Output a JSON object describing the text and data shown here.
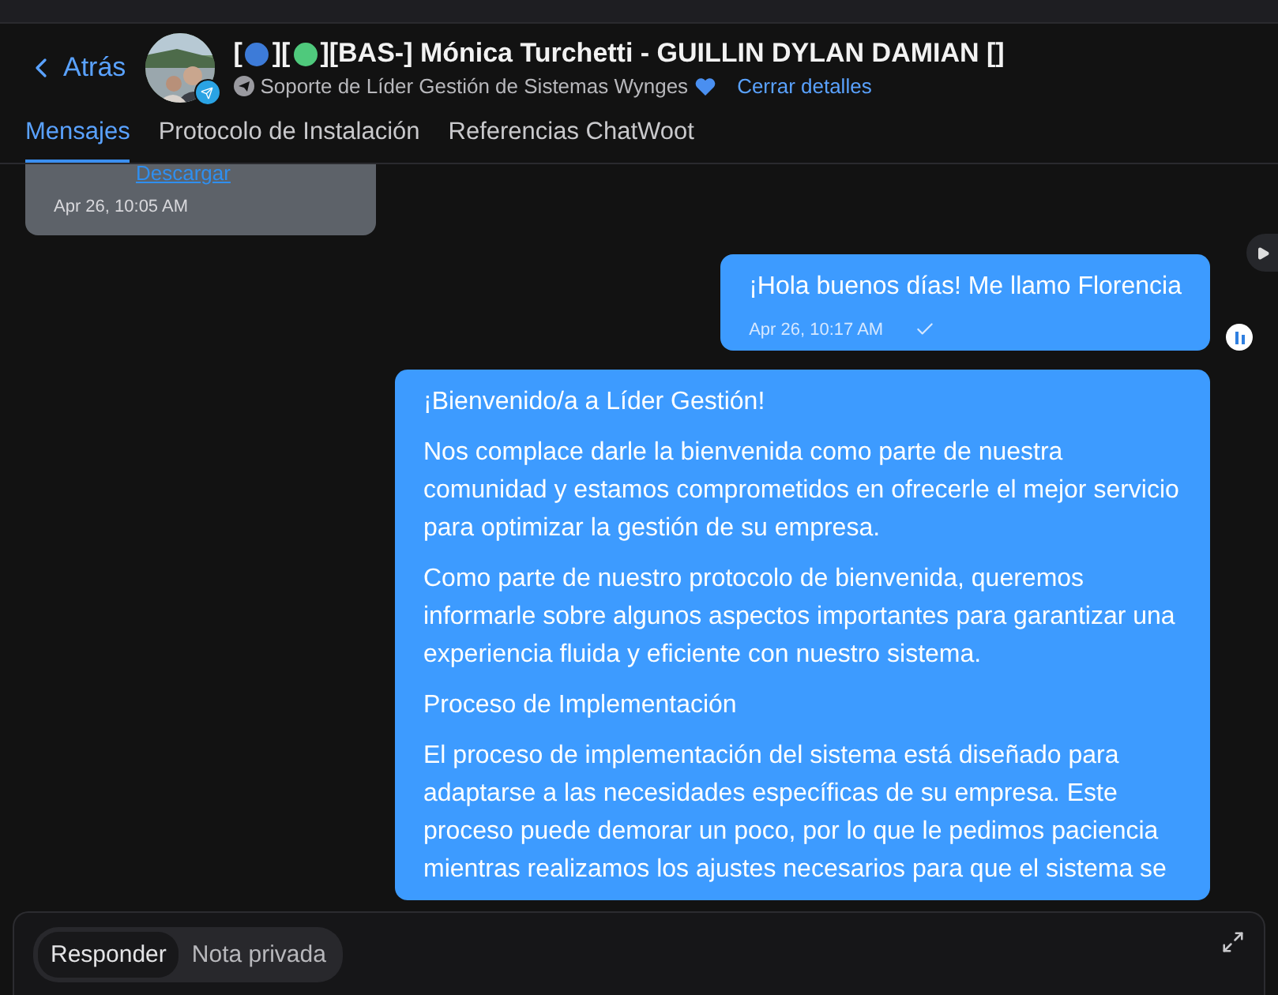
{
  "header": {
    "back": "Atrás",
    "title_parts": [
      {
        "kind": "text",
        "text": "["
      },
      {
        "kind": "dot",
        "color": "#3d7bd8"
      },
      {
        "kind": "text",
        "text": "]["
      },
      {
        "kind": "dot",
        "color": "#4fc97c"
      },
      {
        "kind": "text",
        "text": "][BAS-] Mónica Turchetti - GUILLIN DYLAN DAMIAN []"
      }
    ],
    "inbox": "Soporte de Líder Gestión de Sistemas Wynges",
    "close_details": "Cerrar detalles"
  },
  "tabs": [
    {
      "label": "Mensajes",
      "selected": true
    },
    {
      "label": "Protocolo de Instalación",
      "selected": false
    },
    {
      "label": "Referencias ChatWoot",
      "selected": false
    }
  ],
  "messages": [
    {
      "kind": "incoming",
      "link": "Descargar",
      "time": "Apr 26, 10:05 AM"
    },
    {
      "kind": "outgoing",
      "paragraphs": [
        "¡Hola buenos días! Me llamo Florencia"
      ],
      "time": "Apr 26, 10:17 AM",
      "sent": true
    },
    {
      "kind": "outgoing",
      "paragraphs": [
        "¡Bienvenido/a a Líder Gestión!",
        "Nos complace darle la bienvenida como parte de nuestra comunidad y estamos comprometidos en ofrecerle el mejor servicio para optimizar la gestión de su empresa.",
        "Como parte de nuestro protocolo de bienvenida, queremos informarle sobre algunos aspectos importantes para garantizar una experiencia fluida y eficiente con nuestro sistema.",
        "Proceso de Implementación",
        "El proceso de implementación del sistema está diseñado para adaptarse a las necesidades específicas de su empresa. Este proceso puede demorar un poco, por lo que le pedimos paciencia mientras realizamos los ajustes necesarios para que el sistema se"
      ]
    }
  ],
  "composer": {
    "modes": [
      {
        "label": "Responder",
        "selected": true
      },
      {
        "label": "Nota privada",
        "selected": false
      }
    ]
  }
}
